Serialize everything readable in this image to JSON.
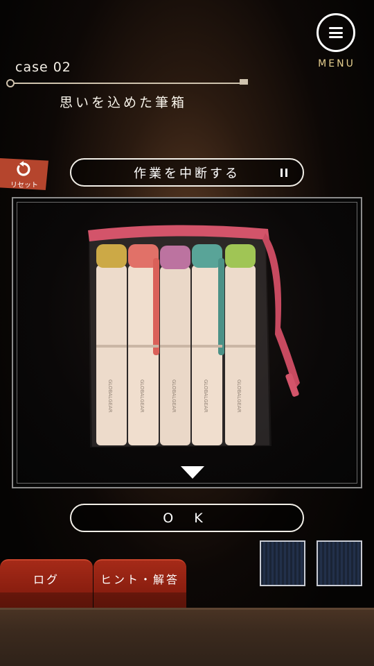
{
  "header": {
    "menu_label": "MENU",
    "case_label": "case 02",
    "case_title": "思いを込めた筆箱"
  },
  "reset": {
    "label": "リセット"
  },
  "toolbar": {
    "suspend_label": "作業を中断する"
  },
  "viewer": {
    "item": "pencil-case-with-markers",
    "marker_brand": "GLOBALGEAR",
    "cap_colors": [
      "#c9a43a",
      "#e0685e",
      "#b86a9a",
      "#4e9e92",
      "#9ac24a"
    ],
    "case_color": "#d3546a"
  },
  "actions": {
    "ok_label": "O K"
  },
  "inventory": {
    "slots": 2
  },
  "bottom_tabs": {
    "log_label": "ログ",
    "hint_label": "ヒント・解答"
  },
  "colors": {
    "accent_gold": "#e6cf8f",
    "tab_red": "#a52a18",
    "reset_red": "#b5452d"
  }
}
